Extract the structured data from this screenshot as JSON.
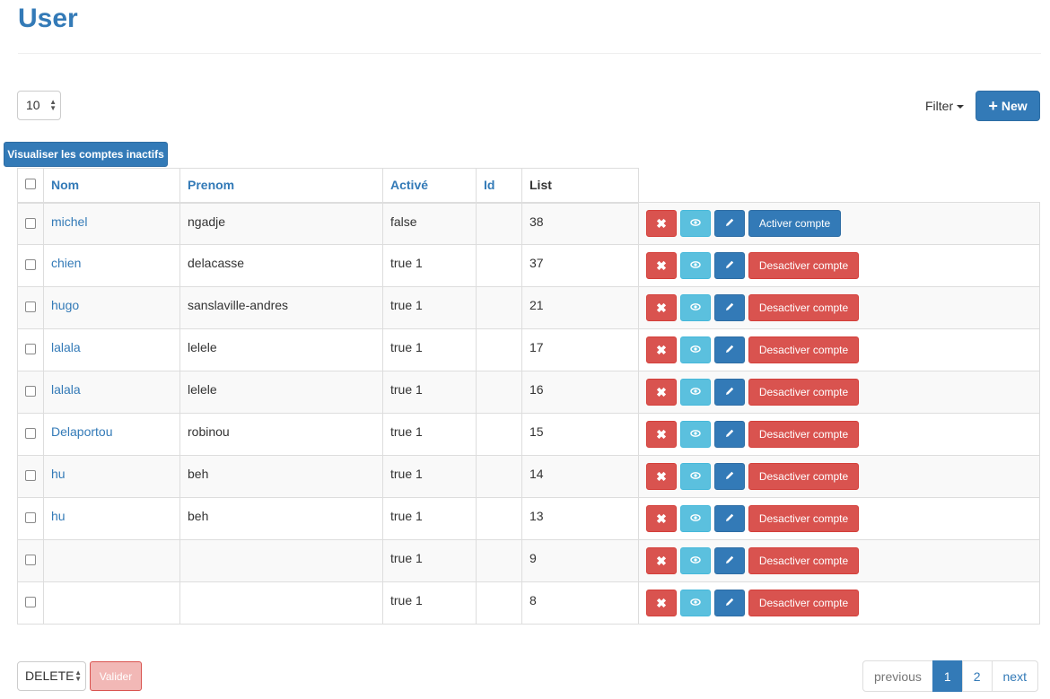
{
  "page": {
    "title": "User"
  },
  "toolbar": {
    "per_page_value": "10",
    "filter_label": "Filter",
    "new_label": "New",
    "inactive_accounts_label": "Visualiser les comptes inactifs"
  },
  "table": {
    "headers": {
      "nom": "Nom",
      "prenom": "Prenom",
      "active": "Activé",
      "id": "Id",
      "list": "List"
    },
    "rows": [
      {
        "nom": "michel",
        "prenom": "ngadje",
        "active": "false",
        "id": "",
        "list": "38",
        "toggle": "Activer compte"
      },
      {
        "nom": "chien",
        "prenom": "delacasse",
        "active": "true 1",
        "id": "",
        "list": "37",
        "toggle": "Desactiver compte"
      },
      {
        "nom": "hugo",
        "prenom": "sanslaville-andres",
        "active": "true 1",
        "id": "",
        "list": "21",
        "toggle": "Desactiver compte"
      },
      {
        "nom": "lalala",
        "prenom": "lelele",
        "active": "true 1",
        "id": "",
        "list": "17",
        "toggle": "Desactiver compte"
      },
      {
        "nom": "lalala",
        "prenom": "lelele",
        "active": "true 1",
        "id": "",
        "list": "16",
        "toggle": "Desactiver compte"
      },
      {
        "nom": "Delaportou",
        "prenom": "robinou",
        "active": "true 1",
        "id": "",
        "list": "15",
        "toggle": "Desactiver compte"
      },
      {
        "nom": "hu",
        "prenom": "beh",
        "active": "true 1",
        "id": "",
        "list": "14",
        "toggle": "Desactiver compte"
      },
      {
        "nom": "hu",
        "prenom": "beh",
        "active": "true 1",
        "id": "",
        "list": "13",
        "toggle": "Desactiver compte"
      },
      {
        "nom": "",
        "prenom": "",
        "active": "true 1",
        "id": "",
        "list": "9",
        "toggle": "Desactiver compte"
      },
      {
        "nom": "",
        "prenom": "",
        "active": "true 1",
        "id": "",
        "list": "8",
        "toggle": "Desactiver compte"
      }
    ],
    "action_icons": {
      "delete": "close-icon",
      "view": "eye-icon",
      "edit": "pencil-icon"
    }
  },
  "footer": {
    "bulk_action_value": "DELETE",
    "submit_label": "Valider"
  },
  "pagination": {
    "previous_label": "previous",
    "pages": [
      "1",
      "2"
    ],
    "current_page": "1",
    "next_label": "next"
  },
  "colors": {
    "primary": "#337ab7",
    "danger": "#d9534f",
    "info": "#5bc0de"
  }
}
